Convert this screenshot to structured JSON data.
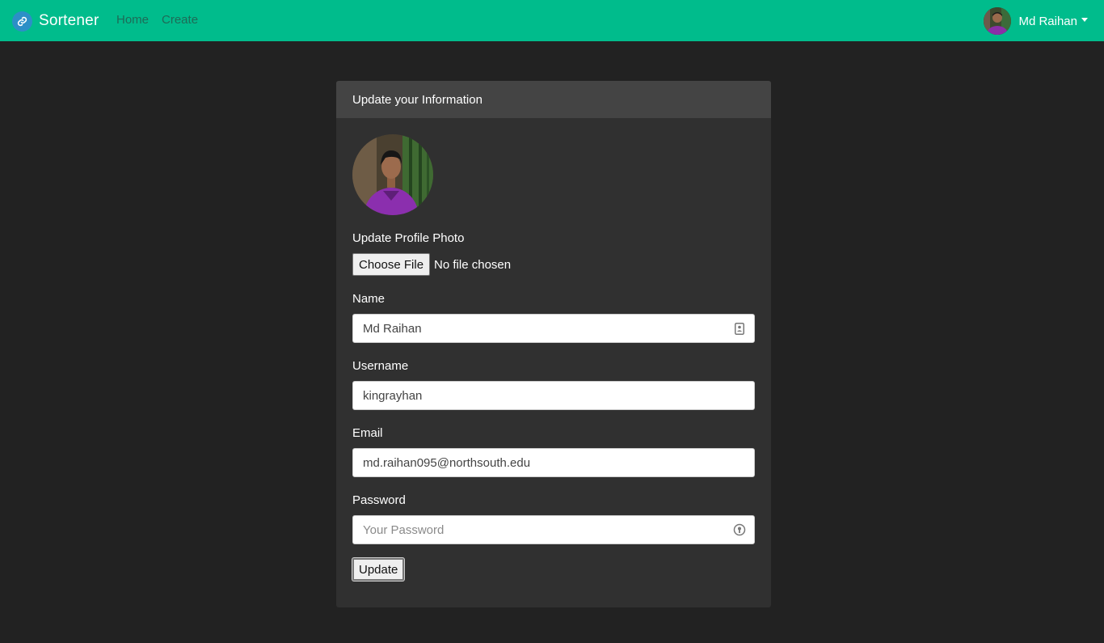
{
  "navbar": {
    "brand": "Sortener",
    "links": [
      "Home",
      "Create"
    ],
    "user_name": "Md Raihan",
    "color": "#00bc8c"
  },
  "card": {
    "title": "Update your Information",
    "photo_label": "Update Profile Photo",
    "choose_file_label": "Choose File",
    "file_status": "No file chosen",
    "fields": {
      "name": {
        "label": "Name",
        "value": "Md Raihan"
      },
      "username": {
        "label": "Username",
        "value": "kingrayhan"
      },
      "email": {
        "label": "Email",
        "value": "md.raihan095@northsouth.edu"
      },
      "password": {
        "label": "Password",
        "value": "",
        "placeholder": "Your Password"
      }
    },
    "submit_label": "Update"
  },
  "icons": {
    "brand": "link-icon",
    "name_field": "contact-card-icon",
    "password_field": "password-manager-icon"
  }
}
